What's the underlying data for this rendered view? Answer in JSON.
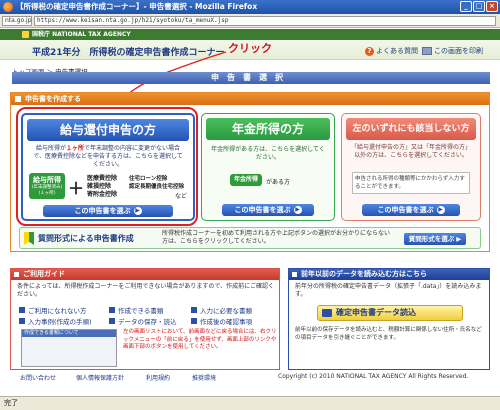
{
  "window": {
    "title": "【所得税の確定申告書作成コーナー】- 申告書選択 - Mozilla Firefox",
    "favicon_label": "nta.go.jp",
    "url": "https://www.keisan.nta.go.jp/h21/syotoku/ta_menuX.jsp",
    "status": "完了",
    "min_label": "_",
    "max_label": "□",
    "close_label": "×"
  },
  "site": {
    "agency": "国税庁 NATIONAL TAX AGENCY",
    "page_title": "平成21年分　所得税の確定申告書作成コーナー",
    "faq_label": "よくある質問",
    "print_label": "この画面を印刷",
    "annotation": "クリック"
  },
  "breadcrumb": {
    "home": "トップ画面",
    "sep": "＞",
    "current": "申告書選択"
  },
  "section_title": "申告書選択",
  "create_section": {
    "title": "申告書を作成する",
    "salary": {
      "title": "給与還付申告の方",
      "desc_pre": "給与所得が",
      "desc_highlight": "１ヶ所",
      "desc_post": "で年末調整の内容に変更がない場合で、医療費控除などを申告する方は、こちらを選択してください。",
      "chip1": "給与所得",
      "chip1_sub": "(年末調整済み) (１ヶ所)",
      "plus": "＋",
      "ded1": "医療費控除",
      "ded2": "雑損控除",
      "ded3": "寄附金控除",
      "ded4": "住宅ローン控除",
      "ded5": "認定長期優良住宅控除",
      "etc": "など",
      "button": "この申告書を選ぶ"
    },
    "pension": {
      "title": "年金所得の方",
      "desc": "年金所得がある方は、こちらを選択してください。",
      "chip": "年金所得",
      "chip_suffix": "がある方",
      "button": "この申告書を選ぶ"
    },
    "other": {
      "title": "左のいずれにも該当しない方",
      "desc": "「給与還付申告の方」又は「年金所得の方」以外の方は、こちらを選択してください。",
      "note": "申告される所得の種類等にかかわらず入力することができます。",
      "button": "この申告書を選ぶ"
    },
    "qa": {
      "title": "質問形式による申告書作成",
      "desc": "所得税作成コーナーを初めて利用される方や上記ボタンの選択がお分かりにならない方は、こちらをクリックしてください。",
      "button": "質問形式を選ぶ"
    }
  },
  "guide": {
    "title": "ご利用ガイド",
    "intro": "条件によっては、所得税作成コーナーをご利用できない場合がありますので、作成前にご確認ください。",
    "links": [
      "ご利用になれない方",
      "作成できる書類",
      "入力に必要な書類",
      "入力事例(作成の手順)",
      "データの保存・読込",
      "作成後の確認事項"
    ],
    "note": "左の画面リストにおいて、前画面などに戻る場合には、右クリックメニューの「前に戻る」を使用せず、画面上部のリンクや画面下部のボタンを使用してください。",
    "thumb_caption": "作成できる書類について"
  },
  "previous": {
    "title": "前年以前のデータを読み込む方はこちら",
    "desc": "前年分の所得税の確定申告書データ（拡張子「.data」）を読み込みます。",
    "button": "確定申告書データ読込",
    "note": "前年以前の保存データを読み込むと、税額計算に関係しない住所・氏名などの項目データを引き継ぐことができます。"
  },
  "footer": {
    "links": [
      "お問い合わせ",
      "個人情報保護方針",
      "利用規約",
      "推奨環境"
    ],
    "copyright": "Copyright (c) 2010 NATIONAL TAX AGENCY All Rights Reserved."
  }
}
